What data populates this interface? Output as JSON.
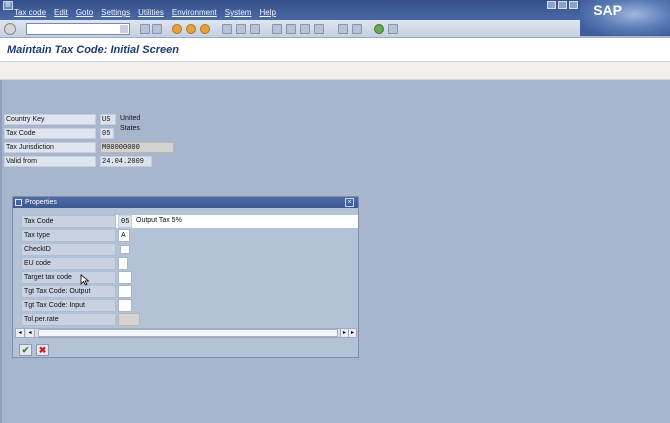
{
  "menu": [
    "Tax code",
    "Edit",
    "Goto",
    "Settings",
    "Utilities",
    "Environment",
    "System",
    "Help"
  ],
  "brand": {
    "logo_text": "SAP"
  },
  "toolbar": {
    "command_value": ""
  },
  "title": "Maintain Tax Code: Initial Screen",
  "fields": {
    "country_key_label": "Country Key",
    "country_key_value": "US",
    "country_name": "United States",
    "tax_code_label": "Tax Code",
    "tax_code_value": "05",
    "tax_jurisdiction_label": "Tax Jurisdiction",
    "tax_jurisdiction_value": "M00000000",
    "valid_from_label": "Valid from",
    "valid_from_value": "24.04.2009"
  },
  "dialog": {
    "title": "Properties",
    "rows": {
      "tax_code_label": "Tax Code",
      "tax_code_value": "05",
      "tax_code_desc": "Output Tax 5%",
      "tax_type_label": "Tax type",
      "tax_type_value": "A",
      "checkid_label": "CheckID",
      "eu_code_label": "EU code",
      "target_tax_code_label": "Target tax code",
      "tgt_output_label": "Tgt Tax Code: Output",
      "tgt_input_label": "Tgt Tax Code: Input",
      "tol_per_rate_label": "Tol.per.rate"
    },
    "buttons": {
      "ok": "✔",
      "cancel": "✖"
    }
  },
  "colors": {
    "accent": "#1f3b74",
    "background": "#a7b6cc",
    "menubar": "#334f8a"
  }
}
